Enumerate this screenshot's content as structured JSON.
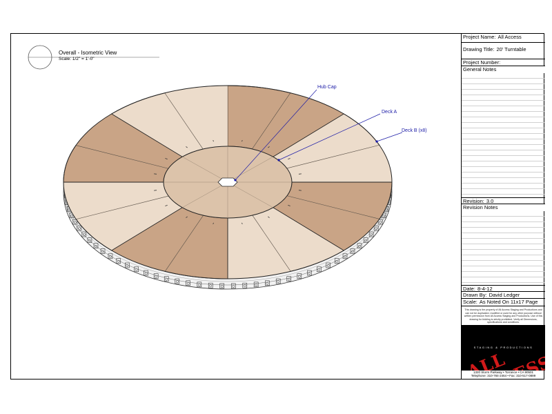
{
  "view": {
    "title": "Overall - Isometric View",
    "scale": "Scale: 1/2\" = 1'-0\""
  },
  "callouts": [
    {
      "id": "hub-cap",
      "label": "Hub Cap"
    },
    {
      "id": "deck-a",
      "label": "Deck A"
    },
    {
      "id": "deck-b",
      "label": "Deck B (x8)"
    }
  ],
  "title_block": {
    "project_name_label": "Project Name:",
    "project_name": "All Access",
    "drawing_title_label": "Drawing Title:",
    "drawing_title": "20' Turntable",
    "project_number_label": "Project Number:",
    "project_number": "",
    "general_notes_label": "General Notes",
    "revision_label": "Revision:",
    "revision": "3.0",
    "revision_notes_label": "Revision Notes",
    "date_label": "Date:",
    "date": "8-4-12",
    "drawn_by_label": "Drawn By:",
    "drawn_by": "David Ledger",
    "scale_label": "Scale:",
    "scale": "As Noted On 11x17 Page",
    "disclaimer": "This drawing is the property of All Access Staging and Productions and can not be duplicated, modified or used for any other purpose without written permission from All Access Staging and Productions. Use of this drawing for bidding is strictly prohibited. Verify all Dimensions, specifications and conditions.",
    "logo_text": "ALL ACCESS",
    "logo_subtext": "STAGING & PRODUCTIONS",
    "address": "1320 Storm Parkway • Torrance • CA 90501",
    "phone": "Telephone: 310-784-2464 • Fax: 310-517-0899"
  },
  "colors": {
    "deck_dark": "#c9a486",
    "deck_light": "#ecdccb",
    "deck_center": "#dcc3aa",
    "callout": "#1a1aa6",
    "logo_red": "#d11a1a"
  }
}
